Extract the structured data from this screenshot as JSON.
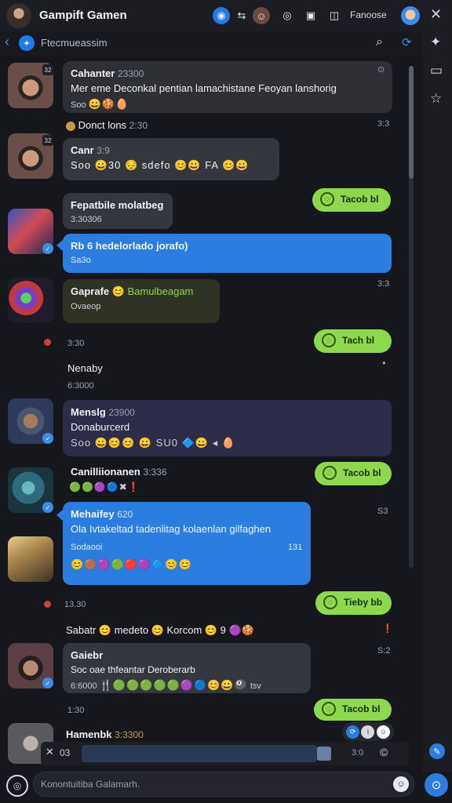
{
  "header": {
    "title": "Gampift Gamen",
    "label": "Fanoose",
    "icons": [
      "blue-circle-icon",
      "arrows-icon",
      "avatar-icon",
      "chat-icon",
      "bookmark-icon",
      "tv-icon",
      "user-badge-icon",
      "close-icon"
    ]
  },
  "subheader": {
    "back": "‹",
    "title": "Ftecmueassim",
    "search": "⌕",
    "sync": "⟳"
  },
  "rail": {
    "pin": "✦",
    "panel": "▭",
    "star": "☆"
  },
  "messages": {
    "m1": {
      "sender": "Cahanter",
      "meta": "23300",
      "text": "Mer eme Deconkal pentian lamachistane Feoyan lanshorig",
      "sub": "Soo",
      "emojis": "😀🍪🥚",
      "tag": "⊙"
    },
    "m2": {
      "line": "Donct lons",
      "time": "2:30",
      "right": "3:3"
    },
    "m3": {
      "sender": "Canr",
      "meta": "3:9",
      "text": "Soo 😀30 😔 sdefo 😊😀 FA 😊😀"
    },
    "m4": {
      "text": "Tacob bl",
      "ic": "◌"
    },
    "m5": {
      "title": "Fepatbile molatbeg",
      "sub": "3:30306"
    },
    "m6": {
      "text": "Rb 6 hedelorlado jorafo)",
      "sub": "Sa3o"
    },
    "m7": {
      "sender": "Gaprafe 😊",
      "meta": "Bamulbeagam",
      "sub": "Ovaeop",
      "right": "3:3"
    },
    "m8": {
      "time": "3:30",
      "text": "Tach bl",
      "ic": "◌"
    },
    "m9": {
      "name": "Nenaby",
      "time": "6:3000"
    },
    "m10": {
      "sender": "Menslg",
      "meta": "23900",
      "text": "Donaburcerd",
      "emojis": "Soo 😀😊😊 😀 SU0 🔷😀 ◂ 🥚"
    },
    "m11": {
      "sender": "Canilliionanen",
      "meta": "3:336",
      "emojis": "🟢🟢🟣🔵✖❗"
    },
    "m12": {
      "text": "Tacob bl",
      "ic": "◌",
      "right": "S3"
    },
    "m13": {
      "sender": "Mehaifey",
      "meta": "620",
      "text": "Ola Ivtakeltad tadenlitag kolaenlan gilfaghen",
      "sub": "Sodaooi",
      "num": "131",
      "emojis": "😊🟤🟣🟢🔴🟣🔷😊😊"
    },
    "m14": {
      "time": "13.30",
      "text": "Tieby bb",
      "ic": "◌"
    },
    "m15": {
      "text": "Sabatr 😊 medeto 😊 Korcom 😊 9 🟣🍪"
    },
    "m16": {
      "sender": "Gaiebr",
      "text": "Soc oae thfeantar Deroberarb",
      "sub": "6:6000",
      "emojis": "🍴🟢🟢🟢🟢🟢🟣🔵😊😀🎱",
      "tail": "tsv",
      "right": "S:2"
    },
    "m17": {
      "time": "1:30",
      "text": "Tacob bl",
      "ic": "◌"
    },
    "m18": {
      "sender": "Hamenbk",
      "meta": "3:3300"
    }
  },
  "reply": {
    "close": "✕",
    "num": "03",
    "time": "3:0",
    "copy": "©"
  },
  "composer": {
    "placeholder": "Konontuitiba Galamarh.",
    "left": "◎",
    "emoji": "☺",
    "send": "⊙"
  }
}
